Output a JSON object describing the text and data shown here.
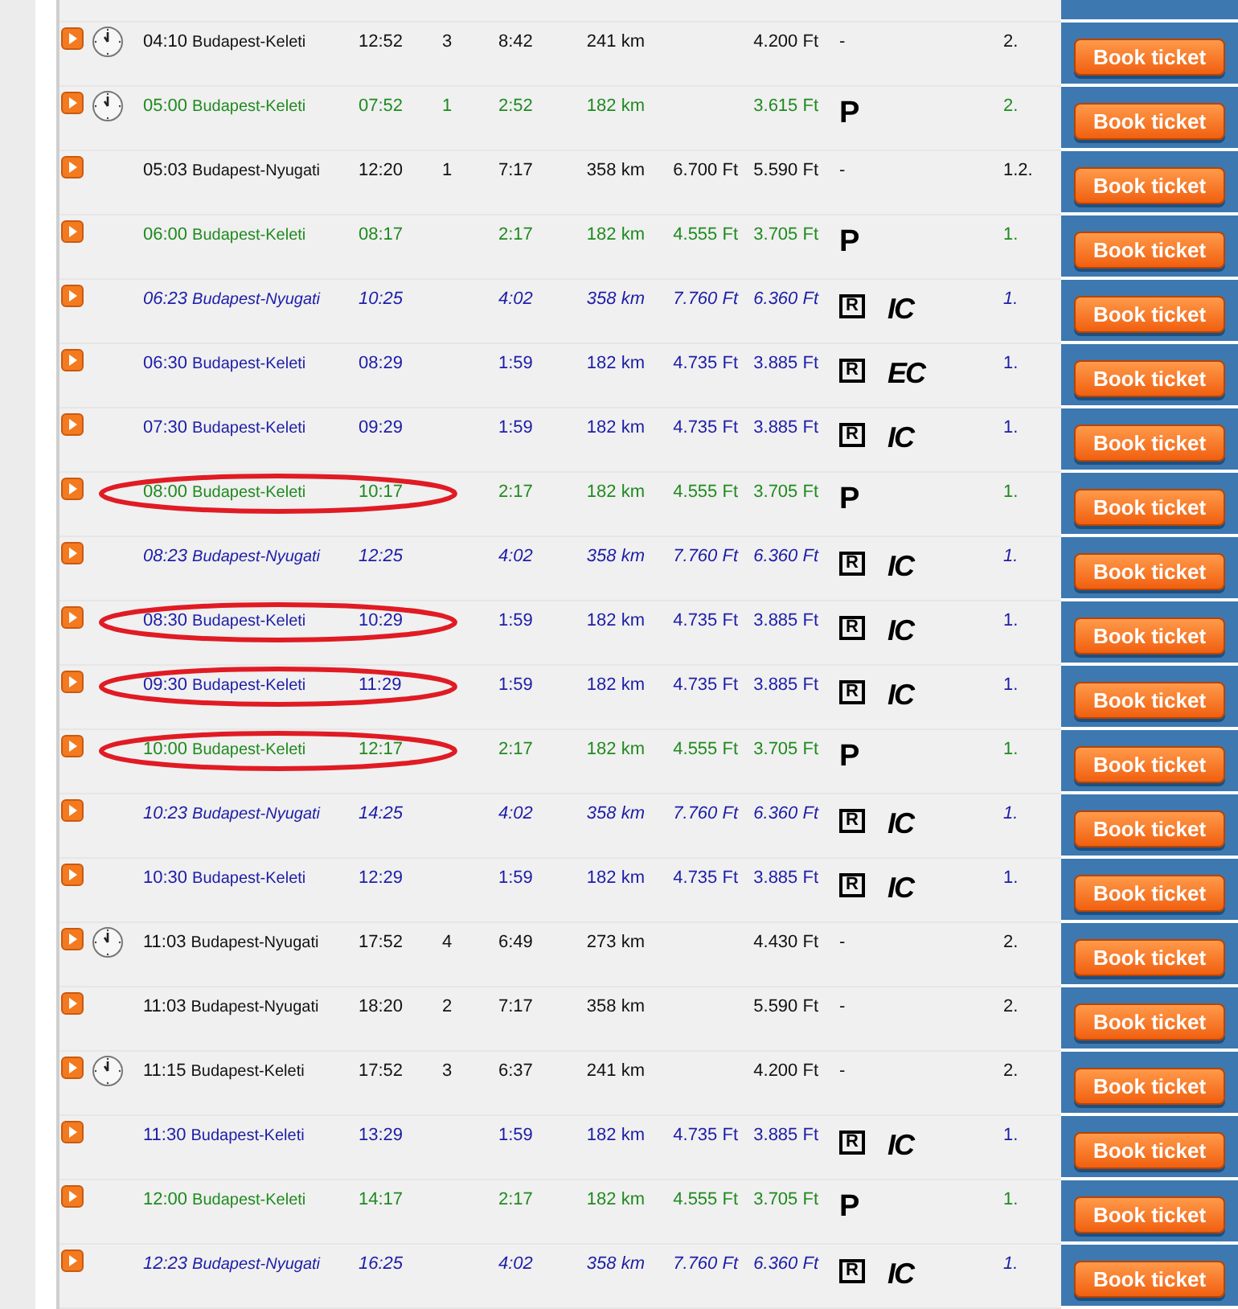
{
  "rows": [
    {
      "kind": "regular",
      "clock": true,
      "highlighted": false,
      "departure": "04:10",
      "station": "Budapest-Keleti",
      "arrival": "12:52",
      "changes": "3",
      "duration": "8:42",
      "distance": "241 km",
      "fare": "4.200 Ft",
      "services": [
        {
          "kind": "plain",
          "text": "-"
        }
      ],
      "train_class": "2.",
      "button": "Book ticket"
    },
    {
      "kind": "green",
      "clock": true,
      "highlighted": false,
      "departure": "05:00",
      "station": "Budapest-Keleti",
      "arrival": "07:52",
      "changes": "1",
      "duration": "2:52",
      "distance": "182 km",
      "fare": "3.615 Ft",
      "services": [
        {
          "kind": "symbol",
          "text": "P"
        }
      ],
      "train_class": "2.",
      "button": "Book ticket"
    },
    {
      "kind": "regular",
      "clock": false,
      "highlighted": false,
      "departure": "05:03",
      "station": "Budapest-Nyugati",
      "arrival": "12:20",
      "changes": "1",
      "duration": "7:17",
      "distance": "358 km",
      "fare_full": "6.700 Ft",
      "fare": "5.590 Ft",
      "services": [
        {
          "kind": "plain",
          "text": "-"
        }
      ],
      "train_class": "1.2.",
      "button": "Book ticket"
    },
    {
      "kind": "green",
      "clock": false,
      "highlighted": false,
      "departure": "06:00",
      "station": "Budapest-Keleti",
      "arrival": "08:17",
      "duration": "2:17",
      "distance": "182 km",
      "fare_full": "4.555 Ft",
      "fare": "3.705 Ft",
      "services": [
        {
          "kind": "symbol",
          "text": "P"
        }
      ],
      "train_class": "1.",
      "button": "Book ticket"
    },
    {
      "kind": "blue_italic",
      "clock": false,
      "highlighted": false,
      "departure": "06:23",
      "station": "Budapest-Nyugati",
      "arrival": "10:25",
      "duration": "4:02",
      "distance": "358 km",
      "fare_full": "7.760 Ft",
      "fare": "6.360 Ft",
      "services": [
        {
          "kind": "boxed",
          "text": "R"
        },
        {
          "kind": "train",
          "text": "IC"
        }
      ],
      "train_class": "1.",
      "button": "Book ticket"
    },
    {
      "kind": "blue",
      "clock": false,
      "highlighted": false,
      "departure": "06:30",
      "station": "Budapest-Keleti",
      "arrival": "08:29",
      "duration": "1:59",
      "distance": "182 km",
      "fare_full": "4.735 Ft",
      "fare": "3.885 Ft",
      "services": [
        {
          "kind": "boxed",
          "text": "R"
        },
        {
          "kind": "train",
          "text": "EC"
        }
      ],
      "train_class": "1.",
      "button": "Book ticket"
    },
    {
      "kind": "blue",
      "clock": false,
      "highlighted": false,
      "departure": "07:30",
      "station": "Budapest-Keleti",
      "arrival": "09:29",
      "duration": "1:59",
      "distance": "182 km",
      "fare_full": "4.735 Ft",
      "fare": "3.885 Ft",
      "services": [
        {
          "kind": "boxed",
          "text": "R"
        },
        {
          "kind": "train",
          "text": "IC"
        }
      ],
      "train_class": "1.",
      "button": "Book ticket"
    },
    {
      "kind": "green",
      "clock": false,
      "highlighted": true,
      "departure": "08:00",
      "station": "Budapest-Keleti",
      "arrival": "10:17",
      "duration": "2:17",
      "distance": "182 km",
      "fare_full": "4.555 Ft",
      "fare": "3.705 Ft",
      "services": [
        {
          "kind": "symbol",
          "text": "P"
        }
      ],
      "train_class": "1.",
      "button": "Book ticket"
    },
    {
      "kind": "blue_italic",
      "clock": false,
      "highlighted": false,
      "departure": "08:23",
      "station": "Budapest-Nyugati",
      "arrival": "12:25",
      "duration": "4:02",
      "distance": "358 km",
      "fare_full": "7.760 Ft",
      "fare": "6.360 Ft",
      "services": [
        {
          "kind": "boxed",
          "text": "R"
        },
        {
          "kind": "train",
          "text": "IC"
        }
      ],
      "train_class": "1.",
      "button": "Book ticket"
    },
    {
      "kind": "blue",
      "clock": false,
      "highlighted": true,
      "departure": "08:30",
      "station": "Budapest-Keleti",
      "arrival": "10:29",
      "duration": "1:59",
      "distance": "182 km",
      "fare_full": "4.735 Ft",
      "fare": "3.885 Ft",
      "services": [
        {
          "kind": "boxed",
          "text": "R"
        },
        {
          "kind": "train",
          "text": "IC"
        }
      ],
      "train_class": "1.",
      "button": "Book ticket"
    },
    {
      "kind": "blue",
      "clock": false,
      "highlighted": true,
      "departure": "09:30",
      "station": "Budapest-Keleti",
      "arrival": "11:29",
      "duration": "1:59",
      "distance": "182 km",
      "fare_full": "4.735 Ft",
      "fare": "3.885 Ft",
      "services": [
        {
          "kind": "boxed",
          "text": "R"
        },
        {
          "kind": "train",
          "text": "IC"
        }
      ],
      "train_class": "1.",
      "button": "Book ticket"
    },
    {
      "kind": "green",
      "clock": false,
      "highlighted": true,
      "departure": "10:00",
      "station": "Budapest-Keleti",
      "arrival": "12:17",
      "duration": "2:17",
      "distance": "182 km",
      "fare_full": "4.555 Ft",
      "fare": "3.705 Ft",
      "services": [
        {
          "kind": "symbol",
          "text": "P"
        }
      ],
      "train_class": "1.",
      "button": "Book ticket"
    },
    {
      "kind": "blue_italic",
      "clock": false,
      "highlighted": false,
      "departure": "10:23",
      "station": "Budapest-Nyugati",
      "arrival": "14:25",
      "duration": "4:02",
      "distance": "358 km",
      "fare_full": "7.760 Ft",
      "fare": "6.360 Ft",
      "services": [
        {
          "kind": "boxed",
          "text": "R"
        },
        {
          "kind": "train",
          "text": "IC"
        }
      ],
      "train_class": "1.",
      "button": "Book ticket"
    },
    {
      "kind": "blue",
      "clock": false,
      "highlighted": false,
      "departure": "10:30",
      "station": "Budapest-Keleti",
      "arrival": "12:29",
      "duration": "1:59",
      "distance": "182 km",
      "fare_full": "4.735 Ft",
      "fare": "3.885 Ft",
      "services": [
        {
          "kind": "boxed",
          "text": "R"
        },
        {
          "kind": "train",
          "text": "IC"
        }
      ],
      "train_class": "1.",
      "button": "Book ticket"
    },
    {
      "kind": "regular",
      "clock": true,
      "highlighted": false,
      "departure": "11:03",
      "station": "Budapest-Nyugati",
      "arrival": "17:52",
      "changes": "4",
      "duration": "6:49",
      "distance": "273 km",
      "fare": "4.430 Ft",
      "services": [
        {
          "kind": "plain",
          "text": "-"
        }
      ],
      "train_class": "2.",
      "button": "Book ticket"
    },
    {
      "kind": "regular",
      "clock": false,
      "highlighted": false,
      "departure": "11:03",
      "station": "Budapest-Nyugati",
      "arrival": "18:20",
      "changes": "2",
      "duration": "7:17",
      "distance": "358 km",
      "fare": "5.590 Ft",
      "services": [
        {
          "kind": "plain",
          "text": "-"
        }
      ],
      "train_class": "2.",
      "button": "Book ticket"
    },
    {
      "kind": "regular",
      "clock": true,
      "highlighted": false,
      "departure": "11:15",
      "station": "Budapest-Keleti",
      "arrival": "17:52",
      "changes": "3",
      "duration": "6:37",
      "distance": "241 km",
      "fare": "4.200 Ft",
      "services": [
        {
          "kind": "plain",
          "text": "-"
        }
      ],
      "train_class": "2.",
      "button": "Book ticket"
    },
    {
      "kind": "blue",
      "clock": false,
      "highlighted": false,
      "departure": "11:30",
      "station": "Budapest-Keleti",
      "arrival": "13:29",
      "duration": "1:59",
      "distance": "182 km",
      "fare_full": "4.735 Ft",
      "fare": "3.885 Ft",
      "services": [
        {
          "kind": "boxed",
          "text": "R"
        },
        {
          "kind": "train",
          "text": "IC"
        }
      ],
      "train_class": "1.",
      "button": "Book ticket"
    },
    {
      "kind": "green",
      "clock": false,
      "highlighted": false,
      "departure": "12:00",
      "station": "Budapest-Keleti",
      "arrival": "14:17",
      "duration": "2:17",
      "distance": "182 km",
      "fare_full": "4.555 Ft",
      "fare": "3.705 Ft",
      "services": [
        {
          "kind": "symbol",
          "text": "P"
        }
      ],
      "train_class": "1.",
      "button": "Book ticket"
    },
    {
      "kind": "blue_italic",
      "clock": false,
      "highlighted": false,
      "departure": "12:23",
      "station": "Budapest-Nyugati",
      "arrival": "16:25",
      "duration": "4:02",
      "distance": "358 km",
      "fare_full": "7.760 Ft",
      "fare": "6.360 Ft",
      "services": [
        {
          "kind": "boxed",
          "text": "R"
        },
        {
          "kind": "train",
          "text": "IC"
        }
      ],
      "train_class": "1.",
      "button": "Book ticket"
    }
  ]
}
